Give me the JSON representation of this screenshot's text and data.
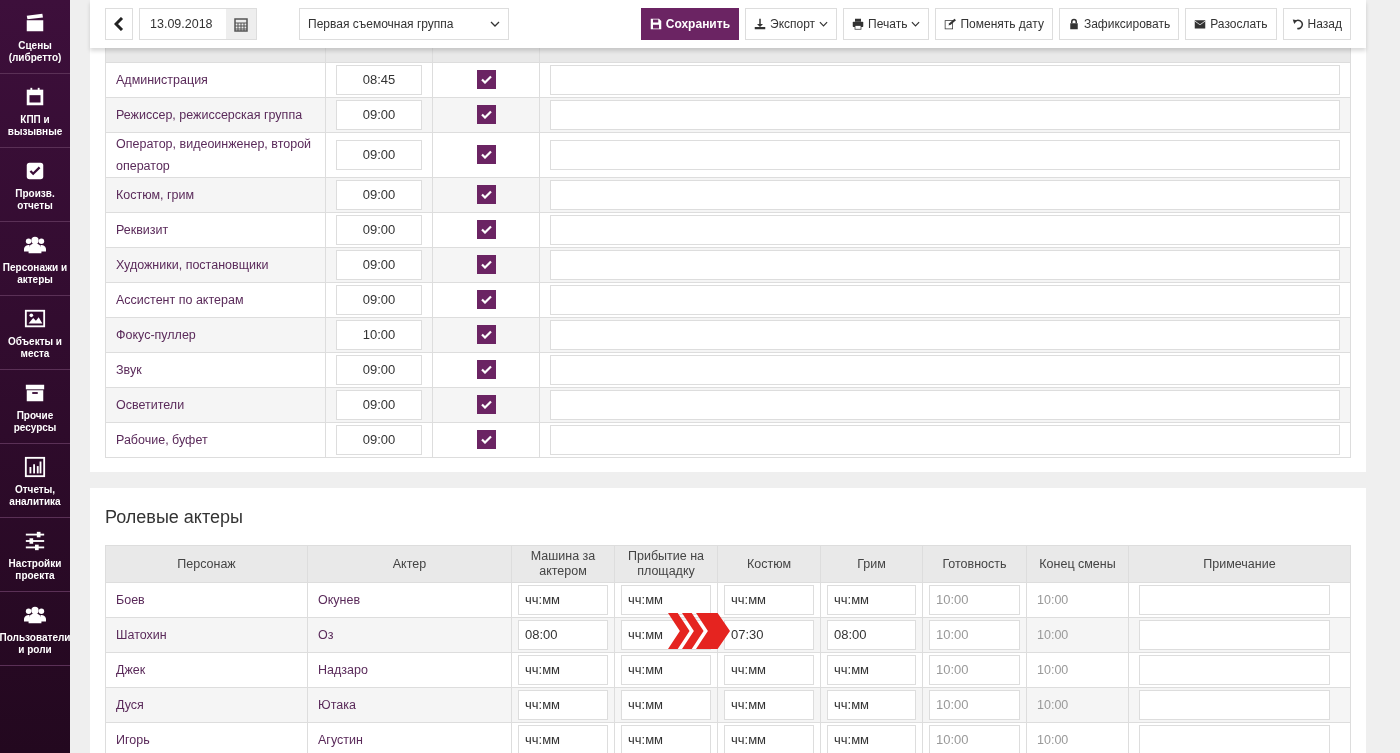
{
  "sidebar": {
    "items": [
      {
        "label": "Сцены (либретто)"
      },
      {
        "label": "КПП и вызывные"
      },
      {
        "label": "Произв. отчеты"
      },
      {
        "label": "Персонажи и актеры"
      },
      {
        "label": "Объекты и места"
      },
      {
        "label": "Прочие ресурсы"
      },
      {
        "label": "Отчеты, аналитика"
      },
      {
        "label": "Настройки проекта"
      },
      {
        "label": "Пользователи и роли"
      }
    ]
  },
  "toolbar": {
    "date": "13.09.2018",
    "group_select": "Первая съемочная группа",
    "buttons": [
      {
        "label": "Сохранить",
        "kind": "primary",
        "dropdown": false
      },
      {
        "label": "Экспорт",
        "kind": "default",
        "dropdown": true
      },
      {
        "label": "Печать",
        "kind": "default",
        "dropdown": true
      },
      {
        "label": "Поменять дату",
        "kind": "default",
        "dropdown": false
      },
      {
        "label": "Зафиксировать",
        "kind": "default",
        "dropdown": false
      },
      {
        "label": "Разослать",
        "kind": "default",
        "dropdown": false
      },
      {
        "label": "Назад",
        "kind": "default",
        "dropdown": false
      }
    ]
  },
  "crew_table": {
    "rows": [
      {
        "name": "Администрация",
        "time": "08:45",
        "checked": true
      },
      {
        "name": "Режиссер, режиссерская группа",
        "time": "09:00",
        "checked": true
      },
      {
        "name": "Оператор, видеоинженер, второй оператор",
        "time": "09:00",
        "checked": true
      },
      {
        "name": "Костюм, грим",
        "time": "09:00",
        "checked": true
      },
      {
        "name": "Реквизит",
        "time": "09:00",
        "checked": true
      },
      {
        "name": "Художники, постановщики",
        "time": "09:00",
        "checked": true
      },
      {
        "name": "Ассистент по актерам",
        "time": "09:00",
        "checked": true
      },
      {
        "name": "Фокус-пуллер",
        "time": "10:00",
        "checked": true
      },
      {
        "name": "Звук",
        "time": "09:00",
        "checked": true
      },
      {
        "name": "Осветители",
        "time": "09:00",
        "checked": true
      },
      {
        "name": "Рабочие, буфет",
        "time": "09:00",
        "checked": true
      }
    ]
  },
  "actors": {
    "title": "Ролевые актеры",
    "columns": [
      "Персонаж",
      "Актер",
      "Машина за актером",
      "Прибытие на площадку",
      "Костюм",
      "Грим",
      "Готовность",
      "Конец смены",
      "Примечание"
    ],
    "rows": [
      {
        "character": "Боев",
        "actor": "Окунев",
        "times": [
          {
            "placeholder": "чч:мм"
          },
          {
            "placeholder": "чч:мм"
          },
          {
            "placeholder": "чч:мм"
          },
          {
            "placeholder": "чч:мм"
          },
          {
            "placeholder": "10:00"
          }
        ],
        "end": "10:00"
      },
      {
        "character": "Шатохин",
        "actor": "Оз",
        "times": [
          {
            "value": "08:00"
          },
          {
            "placeholder": "чч:мм"
          },
          {
            "value": "07:30"
          },
          {
            "value": "08:00"
          },
          {
            "placeholder": "10:00"
          }
        ],
        "end": "10:00"
      },
      {
        "character": "Джек",
        "actor": "Надзаро",
        "times": [
          {
            "placeholder": "чч:мм"
          },
          {
            "placeholder": "чч:мм"
          },
          {
            "placeholder": "чч:мм"
          },
          {
            "placeholder": "чч:мм"
          },
          {
            "placeholder": "10:00"
          }
        ],
        "end": "10:00"
      },
      {
        "character": "Дуся",
        "actor": "Ютака",
        "times": [
          {
            "placeholder": "чч:мм"
          },
          {
            "placeholder": "чч:мм"
          },
          {
            "placeholder": "чч:мм"
          },
          {
            "placeholder": "чч:мм"
          },
          {
            "placeholder": "10:00"
          }
        ],
        "end": "10:00"
      },
      {
        "character": "Игорь",
        "actor": "Агустин",
        "times": [
          {
            "placeholder": "чч:мм"
          },
          {
            "placeholder": "чч:мм"
          },
          {
            "placeholder": "чч:мм"
          },
          {
            "placeholder": "чч:мм"
          },
          {
            "placeholder": "10:00"
          }
        ],
        "end": "10:00"
      }
    ]
  }
}
